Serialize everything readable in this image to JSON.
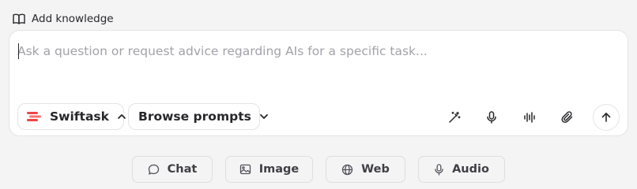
{
  "knowledge": {
    "label": "Add knowledge",
    "icon": "book-open-icon"
  },
  "composer": {
    "placeholder": "Ask a question or request advice regarding AIs for a specific task...",
    "value": ""
  },
  "model_selector": {
    "label": "Swiftask",
    "icon": "swiftask-logo-icon",
    "chevron": "chevron-up-icon",
    "brand_color": "#ef4444"
  },
  "prompts_selector": {
    "label": "Browse prompts",
    "chevron": "chevron-down-icon"
  },
  "toolbar": {
    "tools": [
      "magic-wand-icon",
      "microphone-icon",
      "audio-waveform-icon",
      "paperclip-icon"
    ],
    "send_icon": "arrow-up-icon"
  },
  "modes": [
    {
      "label": "Chat",
      "icon": "chat-bubble-icon"
    },
    {
      "label": "Image",
      "icon": "image-icon"
    },
    {
      "label": "Web",
      "icon": "globe-icon"
    },
    {
      "label": "Audio",
      "icon": "microphone-icon"
    }
  ]
}
